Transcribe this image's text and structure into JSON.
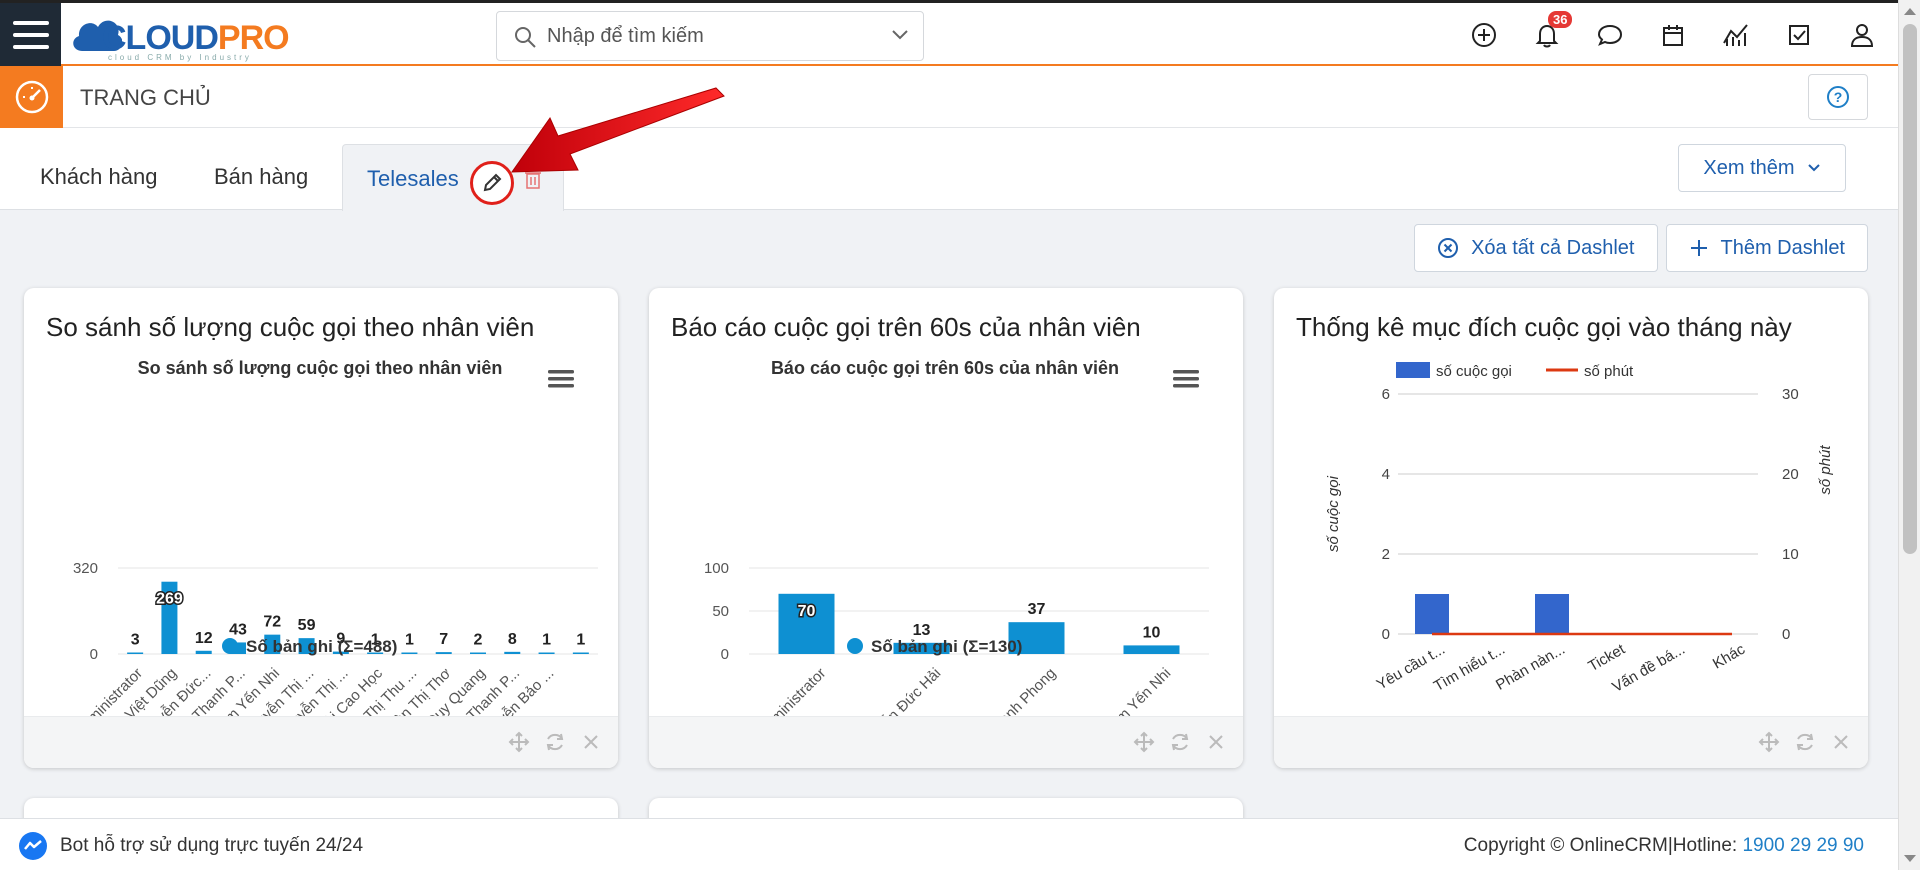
{
  "header": {
    "logo_main_cloud": "CLOUD",
    "logo_main_pro": "PRO",
    "logo_sub": "cloud CRM by Industry",
    "search_placeholder": "Nhập để tìm kiếm",
    "notification_count": "36"
  },
  "subheader": {
    "page_title": "TRANG CHỦ"
  },
  "tabs": [
    {
      "label": "Khách hàng"
    },
    {
      "label": "Bán hàng"
    },
    {
      "label": "Telesales"
    }
  ],
  "more_label": "Xem thêm",
  "actions": {
    "clear_all": "Xóa tất cả Dashlet",
    "add": "Thêm Dashlet"
  },
  "dashlets": [
    {
      "title": "So sánh số lượng cuộc gọi theo nhân viên"
    },
    {
      "title": "Báo cáo cuộc gọi trên 60s của nhân viên"
    },
    {
      "title": "Thống kê mục đích cuộc gọi vào tháng này"
    }
  ],
  "footer": {
    "bot_text": "Bot hỗ trợ sử dụng trực tuyến 24/24",
    "copyright": "Copyright © OnlineCRM|Hotline: ",
    "hotline": "1900 29 29 90"
  },
  "colors": {
    "brand_blue": "#1f5fad",
    "accent_orange": "#f47b20",
    "bar_blue": "#0e90d2",
    "bar_blue2": "#3366cc",
    "line_red": "#dc3912",
    "annotation_red": "#e0201a"
  },
  "chart_data": [
    {
      "type": "bar",
      "title": "So sánh số lượng cuộc gọi theo nhân viên",
      "categories": [
        "Administrator",
        "Vũ Việt Dũng",
        "Nguyễn Đức...",
        "Hà Thanh P...",
        "Phạm Yến Nhi",
        "Nguyễn Thị ...",
        "Nguyễn Thị ...",
        "Bùi Cao Học",
        "Bùi Thị Thu ...",
        "Đoàn Thị Thơ",
        "Duy Quang",
        "Hà Thanh P...",
        "Nguyễn Bảo ..."
      ],
      "series": [
        {
          "name": "Số bản ghi (Σ=488)",
          "values": [
            3,
            269,
            12,
            43,
            72,
            59,
            9,
            1,
            1,
            7,
            2,
            8,
            1,
            1
          ]
        }
      ],
      "yticks": [
        0,
        320
      ],
      "ylim": [
        0,
        320
      ],
      "legend": "bottom"
    },
    {
      "type": "bar",
      "title": "Báo cáo cuộc gọi trên 60s của nhân viên",
      "categories": [
        "Administrator",
        "Nguyễn Đức Hải",
        "Hà Thanh Phong",
        "Phạm Yến Nhi"
      ],
      "series": [
        {
          "name": "Số bản ghi (Σ=130)",
          "values": [
            70,
            13,
            37,
            10
          ]
        }
      ],
      "yticks": [
        0,
        50,
        100
      ],
      "ylim": [
        0,
        100
      ],
      "legend": "bottom"
    },
    {
      "type": "bar",
      "categories": [
        "Yêu cầu t...",
        "Tìm hiểu t...",
        "Phàn nàn...",
        "Ticket",
        "Vấn đề bá...",
        "Khác"
      ],
      "series": [
        {
          "name": "số cuộc gọi",
          "values": [
            1,
            0,
            1,
            0,
            0,
            0
          ]
        },
        {
          "name": "số phút",
          "values": [
            0,
            0,
            0,
            0,
            0,
            0
          ]
        }
      ],
      "ylabel": "số cuộc gọi",
      "y2label": "số phút",
      "yticks": [
        0,
        2,
        4,
        6
      ],
      "y2ticks": [
        0,
        10,
        20,
        30
      ],
      "ylim": [
        0,
        6
      ],
      "y2lim": [
        0,
        30
      ],
      "legend": "top"
    }
  ]
}
